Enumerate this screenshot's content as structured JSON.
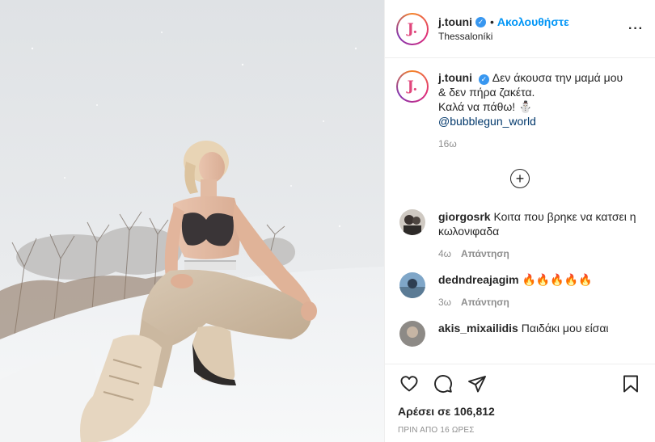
{
  "post": {
    "username": "j.touni",
    "verified_mark": "✓",
    "follow_label": "Ακολουθήστε",
    "separator": "•",
    "location": "Thessaloníki",
    "more_label": "···",
    "avatar_logo": "J."
  },
  "caption": {
    "username": "j.touni",
    "text_line1": "Δεν άκουσα την μαμά μου",
    "text_line2": "& δεν πήρα ζακέτα.",
    "text_line3": "Καλά να πάθω! ⛄",
    "mention": "@bubblegun_world",
    "time": "16ω"
  },
  "load_more_icon": "plus-circle-icon",
  "comments": [
    {
      "username": "giorgosrk",
      "text": "Κοιτα που βρηκε να κατσει η κωλονιφαδα",
      "time": "4ω",
      "reply_label": "Απάντηση"
    },
    {
      "username": "dedndreajagim",
      "text": "🔥🔥🔥🔥🔥",
      "time": "3ω",
      "reply_label": "Απάντηση"
    },
    {
      "username": "akis_mixailidis",
      "text": "Παιδάκι μου είσαι",
      "time": "",
      "reply_label": ""
    }
  ],
  "actions": {
    "icons": [
      "heart-icon",
      "comment-icon",
      "share-icon",
      "bookmark-icon"
    ],
    "likes_text": "Αρέσει σε 106,812",
    "post_time": "ΠΡΙΝ ΑΠΟ 16 ΩΡΕΣ"
  },
  "colors": {
    "link_blue": "#0095f6",
    "verified_blue": "#3897f0",
    "muted": "#8e8e8e",
    "text": "#262626"
  }
}
